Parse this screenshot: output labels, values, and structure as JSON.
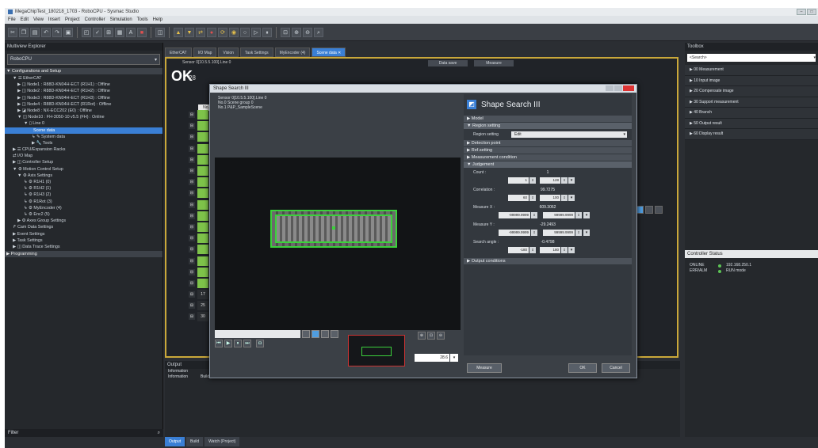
{
  "app": {
    "title": "MegaChipTest_180218_1703 - RoboCPU - Sysmac Studio"
  },
  "menu": [
    "File",
    "Edit",
    "View",
    "Insert",
    "Project",
    "Controller",
    "Simulation",
    "Tools",
    "Help"
  ],
  "explorer": {
    "title": "Multiview Explorer",
    "cpu": "RoboCPU",
    "tree": [
      {
        "label": "▼ Configurations and Setup",
        "indent": 2,
        "kind": "sec"
      },
      {
        "label": "▼ ☰ EtherCAT",
        "indent": 10
      },
      {
        "label": "▶ ◫ Node1 : R88D-KN04H-ECT (R1H1) : Offline",
        "indent": 16
      },
      {
        "label": "▶ ◫ Node2 : R88D-KN04H-ECT (R1H2) : Offline",
        "indent": 16
      },
      {
        "label": "▶ ◫ Node3 : R88D-KN04H-ECT (R1H3) : Offline",
        "indent": 16
      },
      {
        "label": "▶ ◫ Node4 : R88D-KN04H-ECT (R1Rot) : Offline",
        "indent": 16
      },
      {
        "label": "▶ ◪ Node8 : NX-ECC202 (E0) : Offline",
        "indent": 16
      },
      {
        "label": "▼ ◫ Node10 : FH-3050-10 v5.5 (FH) : Online",
        "indent": 16
      },
      {
        "label": "▼ ▯ Line 0",
        "indent": 24
      },
      {
        "label": "Scene data",
        "indent": 36,
        "kind": "sel"
      },
      {
        "label": "↳ ✎ System data",
        "indent": 34
      },
      {
        "label": "▶ 🔧 Tools",
        "indent": 34
      },
      {
        "label": "▶ ☰ CPU/Expansion Racks",
        "indent": 10
      },
      {
        "label": "⇄ I/O Map",
        "indent": 10
      },
      {
        "label": "▶ ◫ Controller Setup",
        "indent": 10
      },
      {
        "label": "▼ ⚙ Motion Control Setup",
        "indent": 10
      },
      {
        "label": "▼ ⚙ Axis Settings",
        "indent": 16
      },
      {
        "label": "↳ ⚙ R1H1 (0)",
        "indent": 24
      },
      {
        "label": "↳ ⚙ R1H2 (1)",
        "indent": 24
      },
      {
        "label": "↳ ⚙ R1H3 (2)",
        "indent": 24
      },
      {
        "label": "↳ ⚙ R1Rot (3)",
        "indent": 24
      },
      {
        "label": "↳ ⚙ MyEncoder (4)",
        "indent": 24
      },
      {
        "label": "↳ ⚙ Enc2 (5)",
        "indent": 24
      },
      {
        "label": "▶ ⚙ Axes Group Settings",
        "indent": 16
      },
      {
        "label": "↱ Cam Data Settings",
        "indent": 10
      },
      {
        "label": "▶ Event Settings",
        "indent": 10
      },
      {
        "label": "▶ Task Settings",
        "indent": 10
      },
      {
        "label": "▶ ◫ Data Trace Settings",
        "indent": 10
      },
      {
        "label": "▶ Programming",
        "indent": 2,
        "kind": "sec"
      }
    ],
    "filter": "Filter"
  },
  "tabs": [
    {
      "label": "EtherCAT"
    },
    {
      "label": "I/O Map"
    },
    {
      "label": "Vision"
    },
    {
      "label": "Task Settings"
    },
    {
      "label": "MyEncoder (4)"
    },
    {
      "label": "Scene data ✕",
      "active": true
    }
  ],
  "scene": {
    "sensor": "Sensor 0[10.5.5.100].Line 0",
    "ok": "OK",
    "ok_suffix": "28",
    "no_header": "No.",
    "data_save": "Data save",
    "measure": "Measure",
    "visible_nums": {
      "16": "17",
      "17": "25",
      "18": "30"
    },
    "rows_count": 19
  },
  "toolbox": {
    "title": "Toolbox",
    "search": "<Search>",
    "items": [
      "00 Measurement",
      "10 Input image",
      "20 Compensate image",
      "30 Support measurement",
      "40 Branch",
      "50 Output result",
      "60 Display result"
    ]
  },
  "controller": {
    "title": "Controller Status",
    "rows": [
      {
        "k": "ONLINE",
        "v": "192.168.250.1"
      },
      {
        "k": "ERR/ALM",
        "v": "RUN mode"
      }
    ]
  },
  "output": {
    "title": "Output",
    "lines": [
      {
        "k": "Information",
        "v": ""
      },
      {
        "k": "Information",
        "v": "Build finished: Vision"
      }
    ]
  },
  "bottom_tabs": [
    {
      "label": "Output",
      "active": true
    },
    {
      "label": "Build"
    },
    {
      "label": "Watch (Project)"
    }
  ],
  "dialog": {
    "title": "Shape Search III",
    "info": [
      "Sensor 0[10.5.5.100].Line 0",
      "No.0 Scene group 0",
      "No.1 P&P_SampleScene"
    ],
    "zoom": "28.6",
    "panel_title": "Shape Search III",
    "sections": {
      "model": "Model",
      "region": "Region setting",
      "detection": "Detection point",
      "ref": "Ref.setting",
      "meas_cond": "Measurement condition",
      "judgement": "Judgement",
      "output": "Output conditions"
    },
    "region_label": "Region setting",
    "region_value": "Edit",
    "judgement": {
      "count_label": "Count :",
      "count_val": "1",
      "count_min": "1",
      "count_max": "128",
      "corr_label": "Correlation :",
      "corr_val": "99.7275",
      "corr_min": "60",
      "corr_max": "100",
      "mx_label": "Measure X :",
      "mx_val": "609.3062",
      "mx_min": "-99999.9999",
      "mx_max": "99999.9999",
      "my_label": "Measure Y :",
      "my_val": "-29.2493",
      "my_min": "-99999.9999",
      "my_max": "99999.9999",
      "angle_label": "Search angle :",
      "angle_val": "-0.4798",
      "angle_min": "-180",
      "angle_max": "180"
    },
    "measure_btn": "Measure",
    "ok_btn": "OK",
    "cancel_btn": "Cancel"
  }
}
